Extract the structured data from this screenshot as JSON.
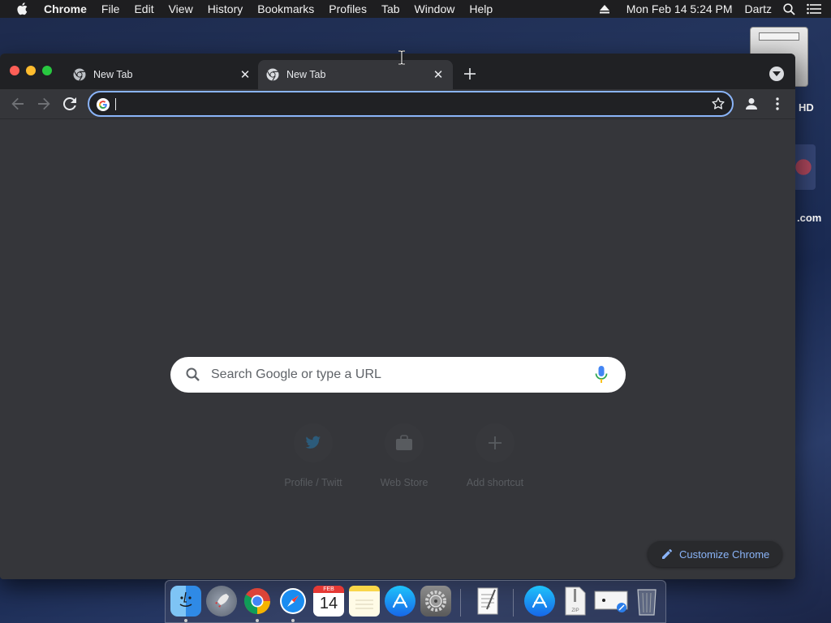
{
  "menubar": {
    "app_name": "Chrome",
    "items": [
      "File",
      "Edit",
      "View",
      "History",
      "Bookmarks",
      "Profiles",
      "Tab",
      "Window",
      "Help"
    ],
    "datetime": "Mon Feb 14  5:24 PM",
    "user": "Dartz"
  },
  "desktop": {
    "drive_label": "HD",
    "app_label": ".com"
  },
  "tabs": [
    {
      "title": "New Tab",
      "active": false
    },
    {
      "title": "New Tab",
      "active": true
    }
  ],
  "omnibox": {
    "value": "",
    "focused": true
  },
  "ntp": {
    "search_placeholder": "Search Google or type a URL",
    "shortcuts": [
      {
        "label": "Profile / Twitt",
        "icon": "twitter-icon"
      },
      {
        "label": "Web Store",
        "icon": "web-store-icon"
      },
      {
        "label": "Add shortcut",
        "icon": "plus-icon"
      }
    ],
    "customize_label": "Customize Chrome"
  },
  "dock": {
    "apps": [
      "Finder",
      "Launchpad",
      "Google Chrome",
      "Safari",
      "Calendar",
      "Notes",
      "App Store",
      "System Preferences",
      "TextEdit",
      "Applications",
      "Archive",
      "Preview",
      "Trash"
    ],
    "calendar_month": "FEB",
    "calendar_day": "14"
  },
  "colors": {
    "accent": "#8ab4f8",
    "window_bg": "#35363a",
    "tabstrip_bg": "#202124",
    "close": "#ff5f57",
    "minimize": "#febc2e",
    "zoom": "#28c840"
  }
}
